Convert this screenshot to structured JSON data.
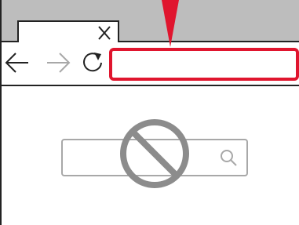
{
  "window": {
    "tab_title": "",
    "address_value": ""
  },
  "icons": {
    "tab_close": "close-icon",
    "back": "arrow-left-icon",
    "forward": "arrow-right-icon",
    "reload": "reload-icon",
    "search": "search-icon",
    "blocked": "prohibited-icon",
    "pointer": "red-pointer-arrow-icon"
  },
  "content": {
    "search_value": ""
  },
  "colors": {
    "highlight": "#e0152e",
    "tab_strip": "#bdbdbd",
    "outline": "#222222",
    "disabled": "#a8a8a8",
    "blocked_symbol": "#8c8c8c"
  }
}
